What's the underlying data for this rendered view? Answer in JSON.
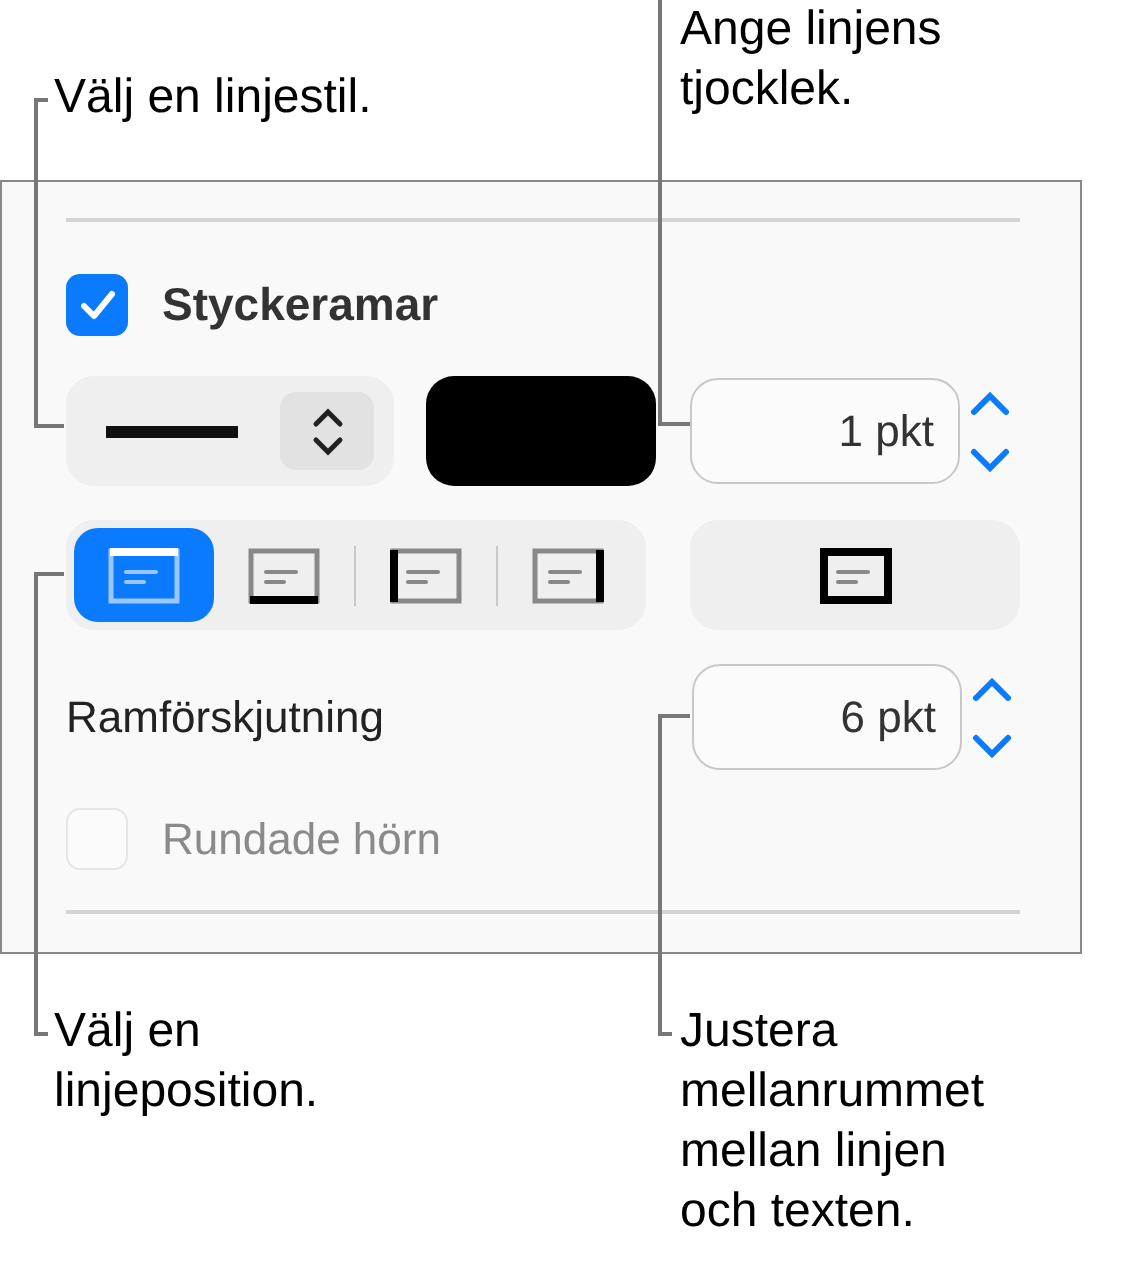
{
  "callouts_top": [
    {
      "text": "Välj en linjestil."
    },
    {
      "text": "Ange linjens\ntjocklek."
    }
  ],
  "panel": {
    "borders": {
      "label": "Styckeramar",
      "checked": true
    },
    "line_style": {
      "kind": "solid"
    },
    "color_well": {
      "color": "#000000"
    },
    "thickness": {
      "value": "1 pkt"
    },
    "positions": [
      {
        "kind": "top",
        "selected": true
      },
      {
        "kind": "bottom",
        "selected": false
      },
      {
        "kind": "left",
        "selected": false
      },
      {
        "kind": "right",
        "selected": false
      }
    ],
    "outline": {
      "kind": "all",
      "selected": false
    },
    "offset": {
      "label": "Ramförskjutning",
      "value": "6 pkt"
    },
    "rounded": {
      "label": "Rundade hörn",
      "checked": false,
      "disabled": true
    }
  },
  "callouts_bottom": [
    {
      "text": "Välj en\nlinjeposition."
    },
    {
      "text": "Justera\nmellanrummet\nmellan linjen\noch texten."
    }
  ]
}
